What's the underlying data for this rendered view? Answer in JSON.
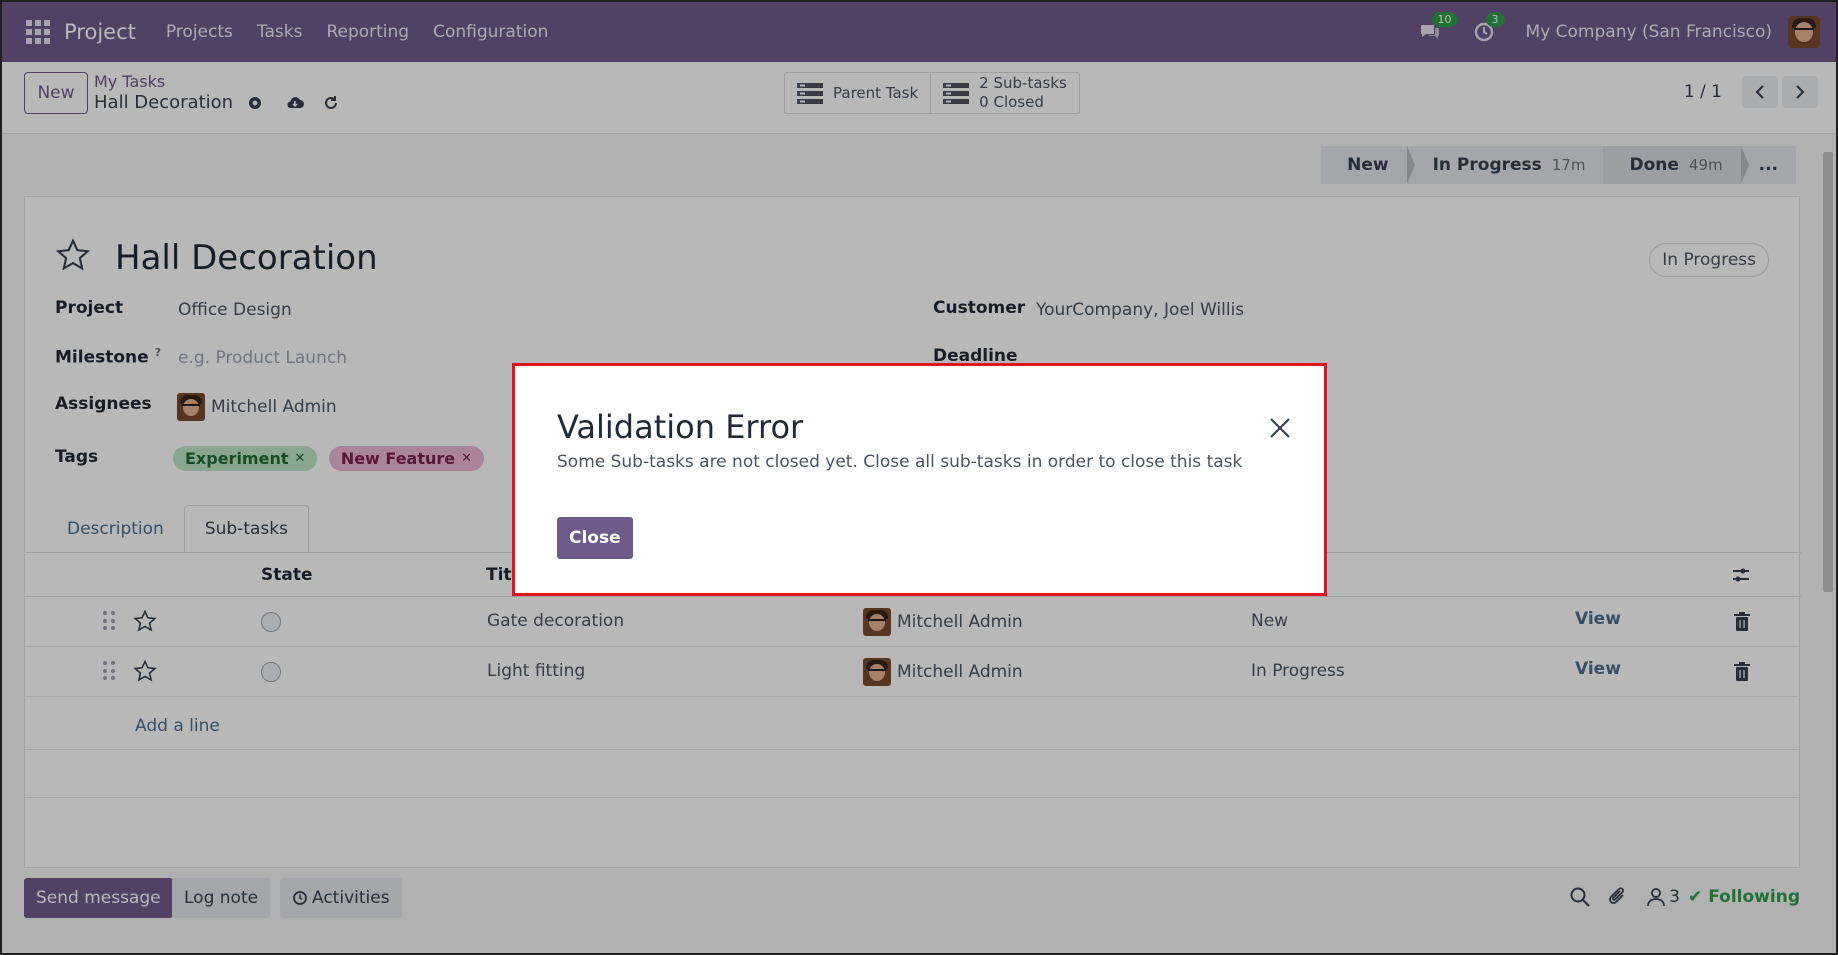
{
  "navbar": {
    "app_name": "Project",
    "menu": [
      "Projects",
      "Tasks",
      "Reporting",
      "Configuration"
    ],
    "messages_count": "10",
    "activities_count": "3",
    "company": "My Company (San Francisco)"
  },
  "control": {
    "new_label": "New",
    "breadcrumb": "My Tasks",
    "record_name": "Hall Decoration",
    "parent_task_label": "Parent Task",
    "subtasks_count_label": "2 Sub-tasks",
    "subtasks_closed_label": "0 Closed",
    "pager": "1 / 1"
  },
  "statusbar": {
    "stages": [
      {
        "label": "New",
        "time": ""
      },
      {
        "label": "In Progress",
        "time": "17m"
      },
      {
        "label": "Done",
        "time": "49m"
      }
    ],
    "more": "..."
  },
  "form": {
    "title": "Hall Decoration",
    "state": "In Progress",
    "project_label": "Project",
    "project_value": "Office Design",
    "milestone_label": "Milestone",
    "milestone_help": "?",
    "milestone_placeholder": "e.g. Product Launch",
    "assignees_label": "Assignees",
    "assignee": "Mitchell Admin",
    "tags_label": "Tags",
    "tags": [
      "Experiment",
      "New Feature"
    ],
    "customer_label": "Customer",
    "customer_value": "YourCompany, Joel Willis",
    "deadline_label": "Deadline"
  },
  "tabs": [
    "Description",
    "Sub-tasks"
  ],
  "subtasks": {
    "headers": {
      "state": "State",
      "title": "Title"
    },
    "rows": [
      {
        "title": "Gate decoration",
        "assignee": "Mitchell Admin",
        "stage": "New",
        "action": "View"
      },
      {
        "title": "Light fitting",
        "assignee": "Mitchell Admin",
        "stage": "In Progress",
        "action": "View"
      }
    ],
    "add_line": "Add a line"
  },
  "chatter": {
    "send_message": "Send message",
    "log_note": "Log note",
    "activities": "Activities",
    "followers_count": "3",
    "following": "Following"
  },
  "dialog": {
    "title": "Validation Error",
    "message": "Some Sub-tasks are not closed yet. Close all sub-tasks in order to close this task",
    "close_label": "Close"
  },
  "colors": {
    "brand": "#6f5a8c",
    "highlight_border": "#e0141e",
    "following": "#2f9c4a"
  }
}
